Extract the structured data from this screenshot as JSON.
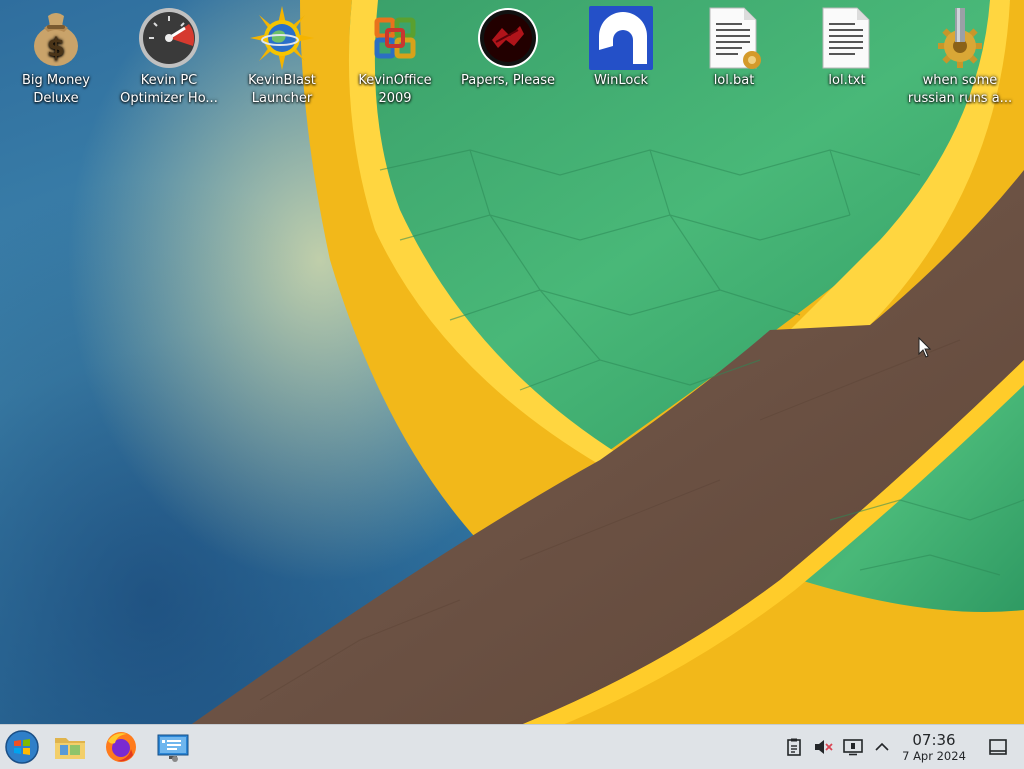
{
  "desktop": {
    "icons": [
      {
        "label": "Big Money\nDeluxe",
        "icon": "money-bag-icon"
      },
      {
        "label": "Kevin PC\nOptimizer Ho...",
        "icon": "speedometer-icon"
      },
      {
        "label": "KevinBlast\nLauncher",
        "icon": "globe-sun-icon"
      },
      {
        "label": "KevinOffice\n2009",
        "icon": "office-logo-icon"
      },
      {
        "label": "Papers, Please",
        "icon": "papers-please-icon"
      },
      {
        "label": "WinLock",
        "icon": "winlock-icon"
      },
      {
        "label": "lol.bat",
        "icon": "batch-file-icon"
      },
      {
        "label": "lol.txt",
        "icon": "text-file-icon"
      },
      {
        "label": "when some\nrussian runs a...",
        "icon": "gear-executable-icon"
      }
    ]
  },
  "taskbar": {
    "pinned": [
      {
        "name": "start-button",
        "icon": "windows-orb-icon"
      },
      {
        "name": "file-manager-button",
        "icon": "folder-icon"
      },
      {
        "name": "firefox-button",
        "icon": "firefox-icon"
      },
      {
        "name": "remote-desktop-button",
        "icon": "monitor-app-icon"
      }
    ],
    "tray": [
      {
        "name": "clipboard-tray",
        "icon": "clipboard-icon"
      },
      {
        "name": "volume-tray",
        "icon": "volume-muted-icon"
      },
      {
        "name": "display-tray",
        "icon": "display-icon"
      },
      {
        "name": "tray-expand",
        "icon": "chevron-up-icon"
      }
    ],
    "clock": {
      "time": "07:36",
      "date": "7 Apr 2024"
    },
    "show_desktop_icon": "show-desktop-icon"
  },
  "colors": {
    "taskbar_bg": "#dfe3e7",
    "wallpaper_green": "#3fae6e",
    "wallpaper_yellow": "#f7c51a",
    "wallpaper_brown": "#6e5446",
    "wallpaper_blue": "#2f6e9e"
  }
}
